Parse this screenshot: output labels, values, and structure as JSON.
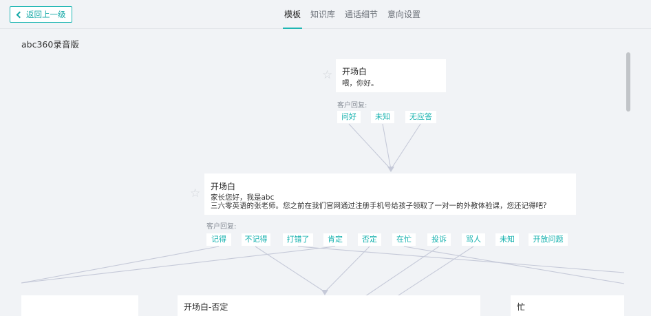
{
  "header": {
    "back_label": "返回上一级",
    "tabs": [
      {
        "label": "模板",
        "active": true
      },
      {
        "label": "知识库",
        "active": false
      },
      {
        "label": "通话细节",
        "active": false
      },
      {
        "label": "意向设置",
        "active": false
      }
    ]
  },
  "page_title": "abc360录音版",
  "reply_label": "客户回复:",
  "node1": {
    "title": "开场白",
    "text": "喂，你好。",
    "replies": [
      "问好",
      "未知",
      "无应答"
    ]
  },
  "node2": {
    "title": "开场白",
    "line1": "家长您好，我是abc",
    "line2": "三六零英语的张老师。您之前在我们官网通过注册手机号给孩子领取了一对一的外教体验课，您还记得吧?",
    "replies": [
      "记得",
      "不记得",
      "打错了",
      "肯定",
      "否定",
      "在忙",
      "投诉",
      "骂人",
      "未知",
      "开放问题"
    ]
  },
  "node_bottom_center": {
    "title": "开场白-否定"
  },
  "node_bottom_right": {
    "title": "忙"
  },
  "colors": {
    "accent": "#1fb6b3",
    "link_line": "#c5c9d8",
    "background": "#f1f3f6"
  }
}
